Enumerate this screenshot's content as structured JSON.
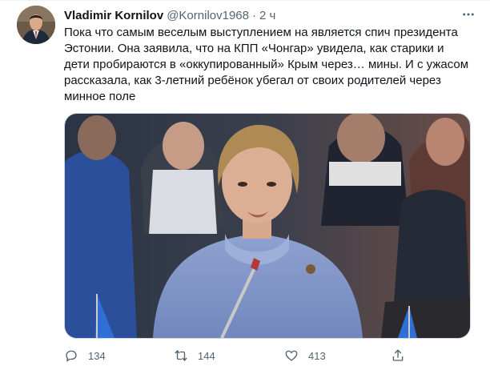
{
  "tweet": {
    "author": {
      "display_name": "Vladimir Kornilov",
      "handle": "@Kornilov1968",
      "separator": "·",
      "time": "2 ч"
    },
    "text": "Пока что самым веселым выступлением на является спич президента Эстонии. Она заявила, что на КПП «Чонгар» увидела, как старики и дети пробираются в «оккупированный» Крым через… мины. И с ужасом рассказала, как 3-летний ребёнок убегал от своих родителей через минное поле",
    "actions": {
      "reply_count": "134",
      "retweet_count": "144",
      "like_count": "413"
    }
  },
  "icons": {
    "more": "more-horizontal-icon",
    "reply": "speech-bubble-icon",
    "retweet": "retweet-arrows-icon",
    "like": "heart-icon",
    "share": "share-upload-icon"
  },
  "colors": {
    "text_primary": "#0f1419",
    "text_secondary": "#536471",
    "border": "#cfd9de"
  }
}
